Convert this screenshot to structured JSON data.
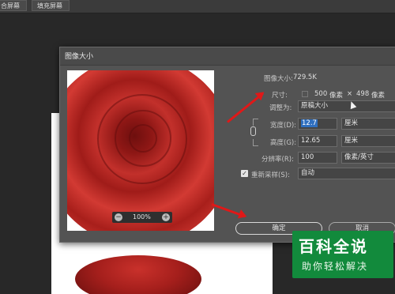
{
  "toolbar": {
    "btn1": "合屏幕",
    "btn2": "填充屏幕"
  },
  "dialog": {
    "title": "图像大小",
    "image_size_label": "图像大小:",
    "image_size_value": "729.5K",
    "dimensions_label": "尺寸:",
    "dim_width": "500",
    "dim_unit": "像素",
    "dim_times": "×",
    "dim_height": "498",
    "dim_unit2": "像素",
    "fit_label": "调整为:",
    "fit_value": "原稿大小",
    "width_label": "宽度(D):",
    "width_value": "12.7",
    "width_unit": "厘米",
    "height_label": "高度(G):",
    "height_value": "12.65",
    "height_unit": "厘米",
    "resolution_label": "分辨率(R):",
    "resolution_value": "100",
    "resolution_unit": "像素/英寸",
    "resample_label": "重新采样(S):",
    "resample_value": "自动",
    "resample_checked": true,
    "zoom": "100%",
    "ok": "确定",
    "cancel": "取消"
  },
  "watermark": {
    "main": "百科全说",
    "sub": "助你轻松解决"
  },
  "colors": {
    "accent": "#2f6fbf",
    "arrow": "#e01818",
    "watermark": "#128a3c"
  }
}
